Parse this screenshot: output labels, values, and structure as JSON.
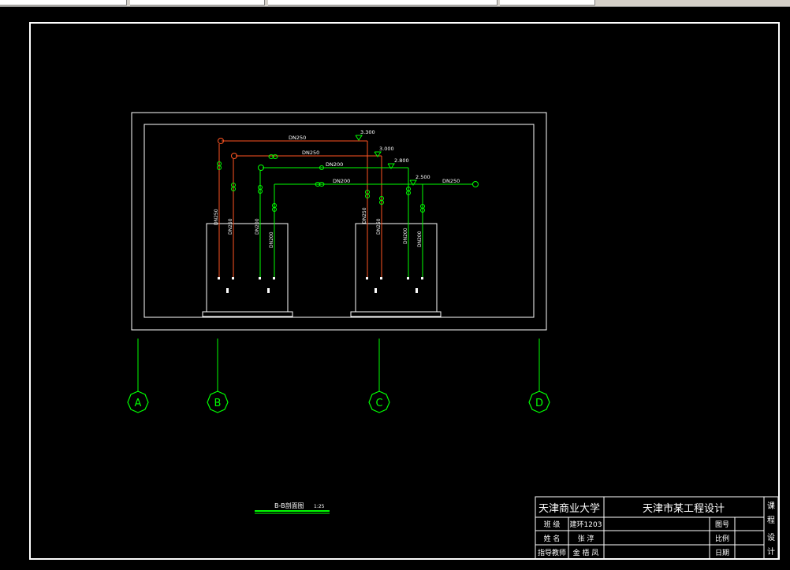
{
  "drawing": {
    "colors": {
      "background": "#000000",
      "frame": "#ffffff",
      "green": "#00ff00",
      "red": "#ff4400",
      "yellow": "#ffff00",
      "axis": "#00ff00"
    },
    "pipe_labels": {
      "top": "DN250",
      "second": "DN250",
      "third": "DN200",
      "fourth": "DN200",
      "right": "DN250"
    },
    "elevations": [
      "3.300",
      "3.000",
      "2.800",
      "2.500"
    ],
    "vertical_labels": {
      "left": [
        "DN250",
        "DN250",
        "DN200",
        "DN200"
      ],
      "right": [
        "DN250",
        "DN250",
        "DN200",
        "DN200"
      ]
    },
    "axis_labels": [
      "A",
      "B",
      "C",
      "D"
    ],
    "section_title": "B-B剖面图",
    "section_scale": "1:25"
  },
  "title_block": {
    "university": "天津商业大学",
    "project": "天津市某工程设计",
    "course_chars": [
      "课",
      "程",
      "设",
      "计"
    ],
    "rows": [
      {
        "label": "班 级",
        "value": "建环1203",
        "field": "图号"
      },
      {
        "label": "姓 名",
        "value": "张 淳",
        "field": "比例"
      },
      {
        "label": "指导教师",
        "value": "金 梧 凤",
        "field": "日期"
      }
    ]
  }
}
